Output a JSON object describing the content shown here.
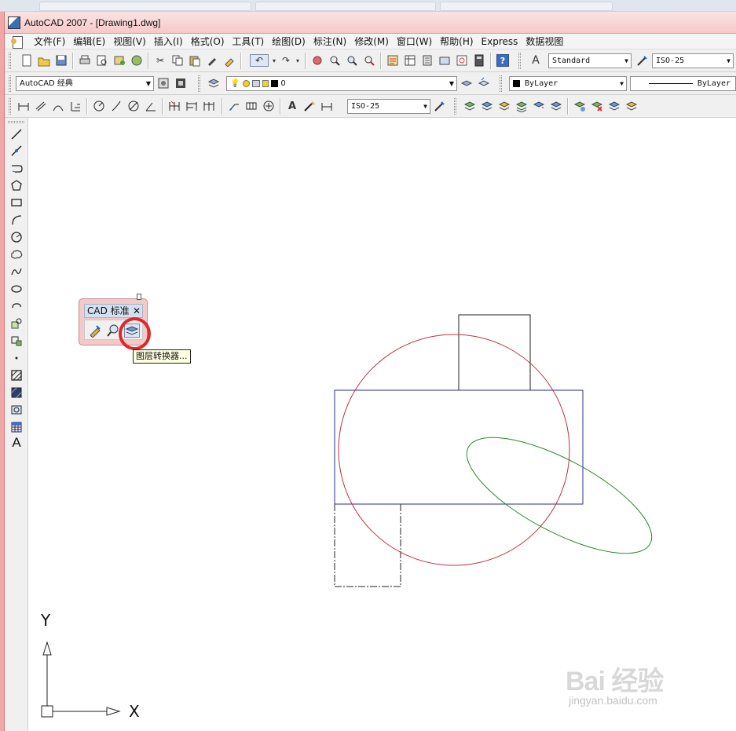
{
  "window": {
    "title": "AutoCAD 2007 - [Drawing1.dwg]"
  },
  "menu": {
    "items": [
      "文件(F)",
      "编辑(E)",
      "视图(V)",
      "插入(I)",
      "格式(O)",
      "工具(T)",
      "绘图(D)",
      "标注(N)",
      "修改(M)",
      "窗口(W)",
      "帮助(H)",
      "Express",
      "数据视图"
    ]
  },
  "toolbar1": {
    "text_style": "Standard",
    "dim_style": "ISO-25"
  },
  "toolbar2": {
    "workspace": "AutoCAD 经典",
    "layer": "0",
    "color": "ByLayer",
    "linetype": "ByLayer"
  },
  "toolbar3": {
    "dim_style": "ISO-25"
  },
  "cad_standards": {
    "title": "CAD 标准",
    "close": "✕",
    "tooltip": "图层转换器..."
  },
  "draw_toolbar": {
    "text_tool_glyph": "A"
  },
  "ucs": {
    "x_label": "X",
    "y_label": "Y"
  },
  "watermark": {
    "brand": "Bai 经验",
    "url": "jingyan.baidu.com"
  },
  "colors": {
    "title_bar": "#f6c9c9",
    "circle": "#c0303a",
    "rectangle": "#2b2b8c",
    "ellipse": "#2a8a2a",
    "highlight": "#e0262a",
    "tooltip_bg": "#ffffe1"
  }
}
